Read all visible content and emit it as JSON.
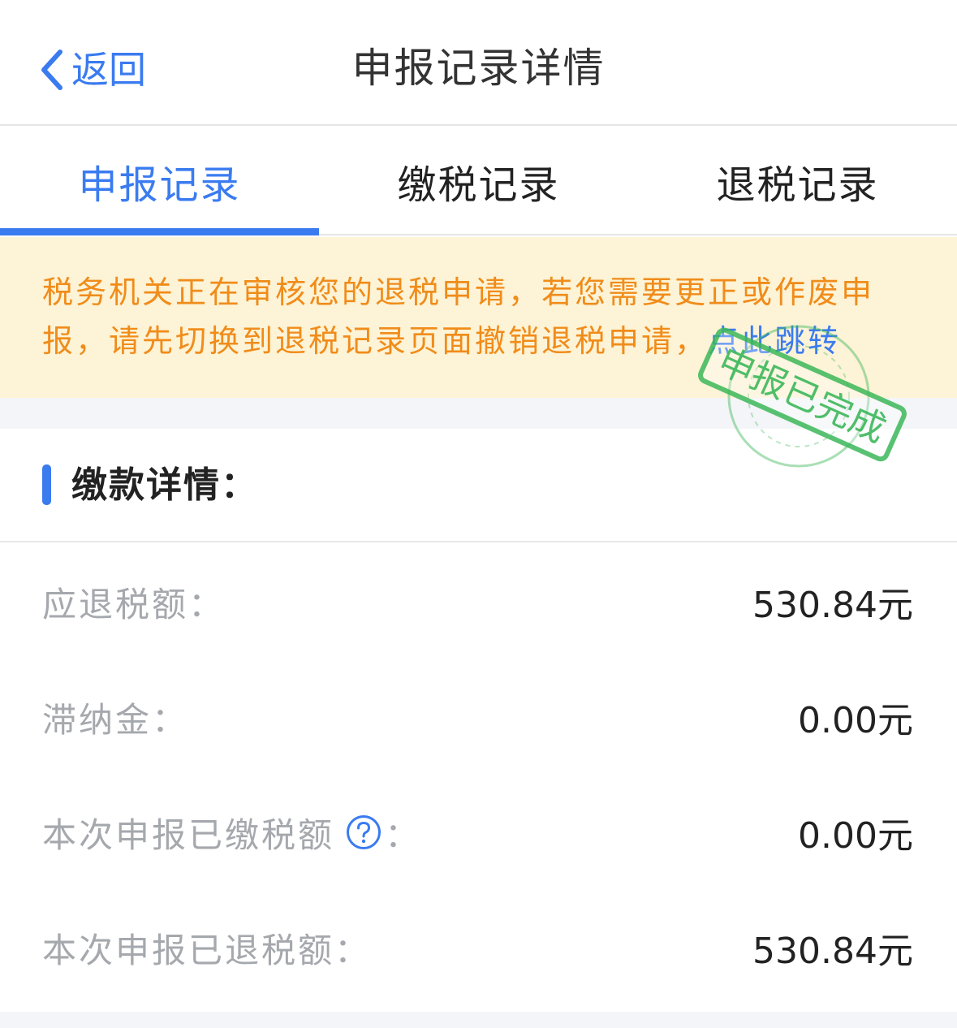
{
  "nav": {
    "back_label": "返回",
    "title": "申报记录详情"
  },
  "tabs": [
    {
      "label": "申报记录",
      "active": true
    },
    {
      "label": "缴税记录",
      "active": false
    },
    {
      "label": "退税记录",
      "active": false
    }
  ],
  "notice": {
    "text": "税务机关正在审核您的退税申请，若您需要更正或作废申报，请先切换到退税记录页面撤销退税申请，",
    "link": "点此跳转"
  },
  "section": {
    "title": "缴款详情："
  },
  "details": [
    {
      "label": "应退税额：",
      "value": "530.84元"
    },
    {
      "label": "滞纳金：",
      "value": "0.00元"
    },
    {
      "label": "本次申报已缴税额",
      "suffix": "：",
      "value": "0.00元",
      "help_icon": true
    },
    {
      "label": "本次申报已退税额：",
      "value": "530.84元"
    }
  ],
  "stamp": {
    "text": "申报已完成"
  },
  "colors": {
    "accent": "#3a7bf0",
    "notice_text": "#f08c1a",
    "notice_bg": "#fdf3d6",
    "stamp": "#3db85a",
    "label": "#a5a8ad"
  }
}
